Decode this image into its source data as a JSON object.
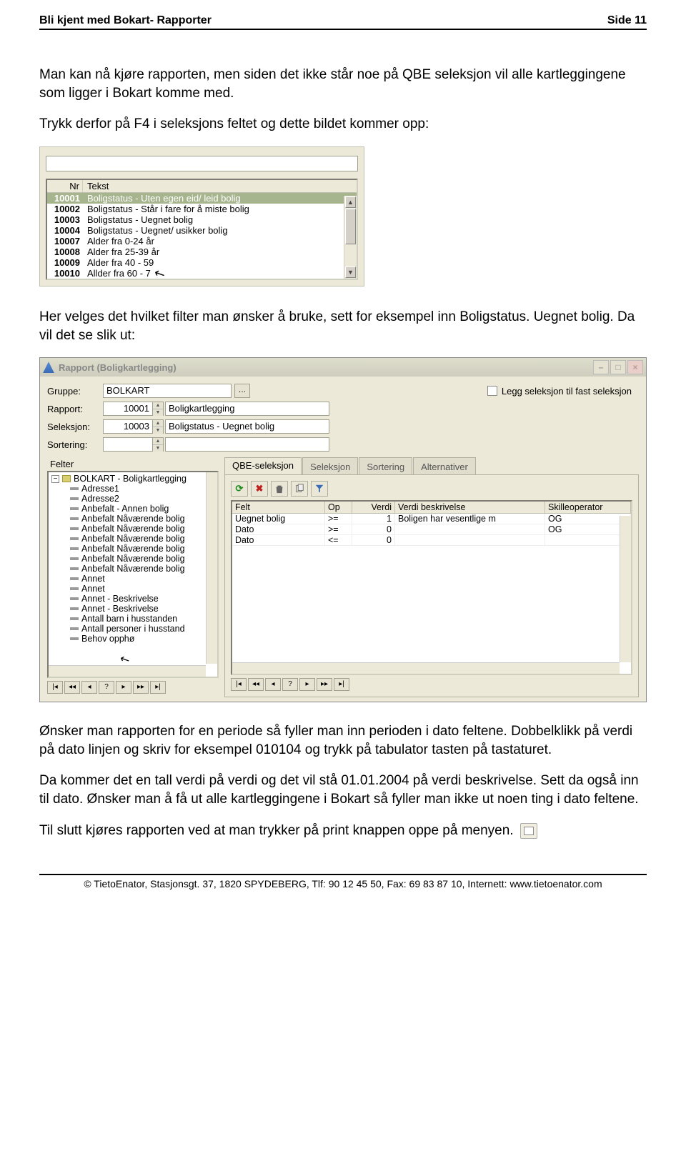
{
  "header": {
    "left": "Bli kjent med Bokart- Rapporter",
    "right": "Side 11"
  },
  "para1": "Man kan nå kjøre rapporten, men siden det ikke står noe på QBE seleksjon vil alle kartleggingene som ligger i Bokart komme med.",
  "para2": "Trykk derfor på F4 i seleksjons feltet og dette bildet kommer opp:",
  "listbox": {
    "headers": {
      "nr": "Nr",
      "tekst": "Tekst"
    },
    "rows": [
      {
        "nr": "10001",
        "tekst": "Boligstatus - Uten egen eid/ leid bolig"
      },
      {
        "nr": "10002",
        "tekst": "Boligstatus - Står i fare for å miste bolig"
      },
      {
        "nr": "10003",
        "tekst": "Boligstatus - Uegnet bolig"
      },
      {
        "nr": "10004",
        "tekst": "Boligstatus - Uegnet/ usikker bolig"
      },
      {
        "nr": "10007",
        "tekst": "Alder fra 0-24 år"
      },
      {
        "nr": "10008",
        "tekst": "Alder fra 25-39 år"
      },
      {
        "nr": "10009",
        "tekst": "Alder fra 40 - 59"
      },
      {
        "nr": "10010",
        "tekst": "Allder fra 60 - 7"
      }
    ]
  },
  "para3": "Her velges det hvilket filter man ønsker å bruke, sett for eksempel inn Boligstatus. Uegnet bolig. Da vil det se slik ut:",
  "dialog": {
    "title": "Rapport (Boligkartlegging)",
    "labels": {
      "gruppe": "Gruppe:",
      "rapport": "Rapport:",
      "seleksjon": "Seleksjon:",
      "sortering": "Sortering:"
    },
    "gruppe_value": "BOLKART",
    "rapport_num": "10001",
    "rapport_txt": "Boligkartlegging",
    "seleksjon_num": "10003",
    "seleksjon_txt": "Boligstatus - Uegnet bolig",
    "check_label": "Legg seleksjon til fast seleksjon",
    "left_panel": {
      "header": "Felter",
      "root": "BOLKART - Boligkartlegging",
      "items": [
        "Adresse1",
        "Adresse2",
        "Anbefalt - Annen bolig",
        "Anbefalt Nåværende bolig",
        "Anbefalt Nåværende bolig",
        "Anbefalt Nåværende bolig",
        "Anbefalt Nåværende bolig",
        "Anbefalt Nåværende bolig",
        "Anbefalt Nåværende bolig",
        "Annet",
        "Annet",
        "Annet  - Beskrivelse",
        "Annet - Beskrivelse",
        "Antall barn i husstanden",
        "Antall personer i husstand",
        "Behov opphø"
      ]
    },
    "tabs": [
      "QBE-seleksjon",
      "Seleksjon",
      "Sortering",
      "Alternativer"
    ],
    "grid": {
      "headers": {
        "felt": "Felt",
        "op": "Op",
        "verdi": "Verdi",
        "besk": "Verdi beskrivelse",
        "skille": "Skilleoperator"
      },
      "rows": [
        {
          "felt": "Uegnet bolig",
          "op": ">=",
          "verdi": "1",
          "besk": "Boligen har vesentlige m",
          "skille": "OG"
        },
        {
          "felt": "Dato",
          "op": ">=",
          "verdi": "0",
          "besk": "",
          "skille": "OG"
        },
        {
          "felt": "Dato",
          "op": "<=",
          "verdi": "0",
          "besk": "",
          "skille": ""
        }
      ]
    }
  },
  "para4": "Ønsker man rapporten for en periode så fyller man inn perioden i dato feltene. Dobbelklikk på verdi på dato linjen og skriv for eksempel 010104 og trykk på tabulator tasten på tastaturet.",
  "para5": "Da kommer det en tall verdi på verdi og det vil stå 01.01.2004 på verdi beskrivelse. Sett da også inn til dato. Ønsker man å få ut alle kartleggingene i Bokart så fyller man ikke ut noen ting i dato feltene.",
  "para6": "Til slutt kjøres rapporten ved at man trykker på print knappen oppe på menyen.",
  "footer": "© TietoEnator, Stasjonsgt. 37, 1820 SPYDEBERG, Tlf: 90 12 45 50, Fax: 69 83 87 10, Internett: www.tietoenator.com"
}
